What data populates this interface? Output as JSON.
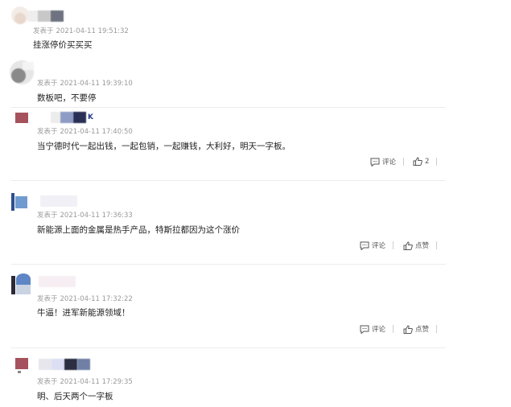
{
  "posted_prefix": "发表于",
  "actions": {
    "comment_label": "评论",
    "like_label": "点赞"
  },
  "colors": {
    "meta_text": "#9a9a9a",
    "body_text": "#222222",
    "divider": "#ececec",
    "username_accent": "#2a3a8c"
  },
  "comments": [
    {
      "time": "2021-04-11 19:51:32",
      "text": "挂涨停价买买买"
    },
    {
      "time": "2021-04-11 19:39:10",
      "text": "数板吧，不要停"
    },
    {
      "username_suffix": "K",
      "time": "2021-04-11 17:40:50",
      "text": "当宁德时代一起出钱，一起包销，一起赚钱，大利好，明天一字板。",
      "like_count": "2"
    },
    {
      "time": "2021-04-11 17:36:33",
      "text": "新能源上面的金属是热手产品，特斯拉都因为这个涨价"
    },
    {
      "time": "2021-04-11 17:32:22",
      "text": "牛逼！进军新能源领域！"
    },
    {
      "time": "2021-04-11 17:29:35",
      "text": "明、后天两个一字板"
    }
  ]
}
